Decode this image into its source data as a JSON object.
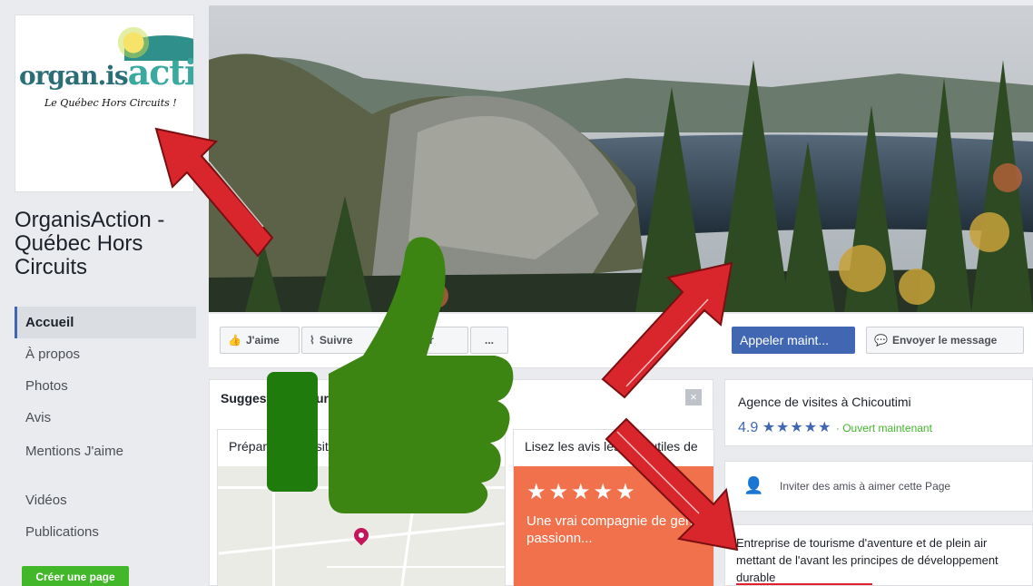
{
  "logo": {
    "word": "organ.is",
    "word_big": "action",
    "tagline": "Le Québec Hors Circuits !"
  },
  "page": {
    "name": "OrganisAction - Québec Hors Circuits"
  },
  "nav": {
    "items": [
      {
        "label": "Accueil"
      },
      {
        "label": "À propos"
      },
      {
        "label": "Photos"
      },
      {
        "label": "Avis"
      },
      {
        "label": "Mentions J'aime"
      },
      {
        "label": "Vidéos"
      },
      {
        "label": "Publications"
      }
    ],
    "create_page": "Créer une page"
  },
  "actions": {
    "like": "J'aime",
    "follow": "Suivre",
    "share": "Partager",
    "more": "...",
    "call": "Appeler maint...",
    "message": "Envoyer le message"
  },
  "suggestions": {
    "title": "Suggestions pour",
    "close": "×",
    "card1_title": "Préparer une visite",
    "card2_title": "Lisez les avis les plus utiles de",
    "review_stars": "★★★★★",
    "review_text": "Une vrai compagnie de gens passionn..."
  },
  "info": {
    "category": "Agence de visites à Chicoutimi",
    "rating": "4.9",
    "stars": "★★★★★",
    "open": "· Ouvert maintenant",
    "invite": "Inviter des amis à aimer cette Page",
    "description": "Entreprise de tourisme d'aventure et de plein air mettant de l'avant les principes de développement durable"
  },
  "colors": {
    "brand": "#4267b2",
    "green": "#42b72a",
    "thumb": "#3a7d12",
    "arrow": "#d9262c",
    "review": "#f1714c"
  },
  "icons": [
    "thumbs-up-icon",
    "rss-icon",
    "messenger-icon",
    "add-friend-icon",
    "close-icon",
    "map-pin-icon"
  ]
}
